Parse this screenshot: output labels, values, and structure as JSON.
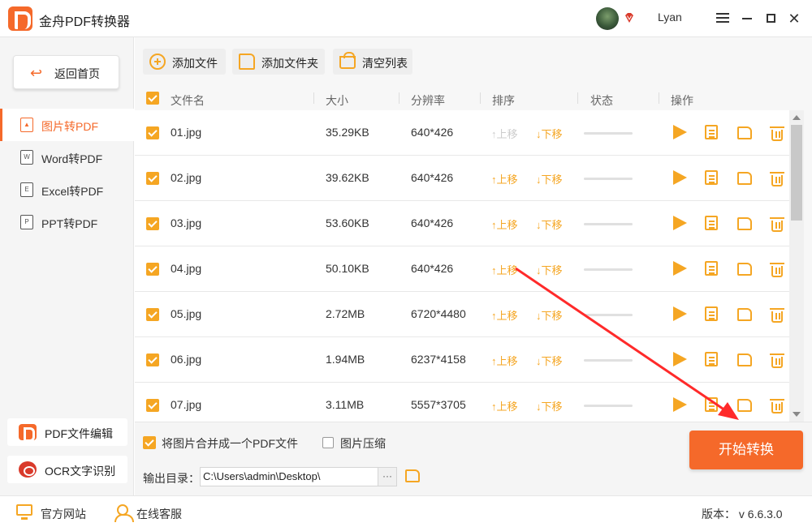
{
  "app": {
    "title": "金舟PDF转换器",
    "username": "Lyan"
  },
  "sidebar": {
    "back_label": "返回首页",
    "items": [
      {
        "label": "图片转PDF",
        "icon": "image-icon",
        "active": true
      },
      {
        "label": "Word转PDF",
        "icon": "word-doc-icon"
      },
      {
        "label": "Excel转PDF",
        "icon": "excel-doc-icon"
      },
      {
        "label": "PPT转PDF",
        "icon": "ppt-doc-icon"
      }
    ],
    "tools": [
      {
        "label": "PDF文件编辑",
        "icon": "pdf-edit-icon"
      },
      {
        "label": "OCR文字识别",
        "icon": "ocr-eye-icon"
      }
    ]
  },
  "toolbar": {
    "add_file": "添加文件",
    "add_folder": "添加文件夹",
    "clear_list": "清空列表"
  },
  "table": {
    "headers": {
      "name": "文件名",
      "size": "大小",
      "resolution": "分辨率",
      "order": "排序",
      "status": "状态",
      "actions": "操作"
    },
    "up_label": "上移",
    "down_label": "下移",
    "rows": [
      {
        "name": "01.jpg",
        "size": "35.29KB",
        "resolution": "640*426"
      },
      {
        "name": "02.jpg",
        "size": "39.62KB",
        "resolution": "640*426"
      },
      {
        "name": "03.jpg",
        "size": "53.60KB",
        "resolution": "640*426"
      },
      {
        "name": "04.jpg",
        "size": "50.10KB",
        "resolution": "640*426"
      },
      {
        "name": "05.jpg",
        "size": "2.72MB",
        "resolution": "6720*4480"
      },
      {
        "name": "06.jpg",
        "size": "1.94MB",
        "resolution": "6237*4158"
      },
      {
        "name": "07.jpg",
        "size": "3.11MB",
        "resolution": "5557*3705"
      }
    ]
  },
  "bottom": {
    "merge_label": "将图片合并成一个PDF文件",
    "compress_label": "图片压缩",
    "output_label": "输出目录：",
    "output_path": "C:\\Users\\admin\\Desktop\\",
    "more_label": "···",
    "start_button": "开始转换"
  },
  "statusbar": {
    "website": "官方网站",
    "service": "在线客服",
    "version": "版本： v 6.6.3.0"
  },
  "colors": {
    "accent": "#f5692a",
    "icon": "#f5a623",
    "annotation": "#ff2a2a"
  }
}
